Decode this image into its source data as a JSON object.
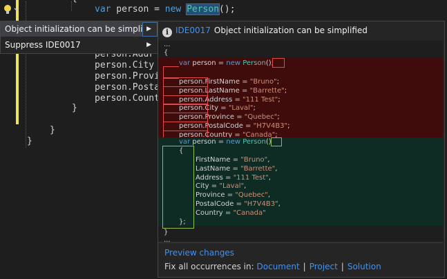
{
  "editor": {
    "line_top": "{",
    "line_var": {
      "kw": "var",
      "name": " person = ",
      "kw2": "new",
      "type": "Person",
      "rest": "();"
    },
    "lines": [
      "person.Addr",
      "person.City",
      "person.Provi",
      "person.Posta",
      "person.Count"
    ],
    "brace_inner": "}",
    "brace_mid": "}",
    "brace_outer": "}"
  },
  "menu": {
    "items": [
      {
        "label": "Object initialization can be simplified",
        "has_submenu": true
      },
      {
        "label": "Suppress IDE0017",
        "has_submenu": true
      }
    ]
  },
  "preview": {
    "diag_id": "IDE0017",
    "title": "Object initialization can be simplified",
    "ellipsis_top": "...",
    "brace_open": "{",
    "removed": {
      "decl": {
        "kw": "var",
        "mid": " person = ",
        "kw2": "new",
        "type": "Person",
        "tail": "();"
      },
      "assignments": [
        {
          "prop": "person.FirstName",
          "eq": " = ",
          "val": "\"Bruno\"",
          "end": ";"
        },
        {
          "prop": "person.LastName",
          "eq": " = ",
          "val": "\"Barrette\"",
          "end": ";"
        },
        {
          "prop": "person.Address",
          "eq": " = ",
          "val": "\"111 Test\"",
          "end": ";"
        },
        {
          "prop": "person.City",
          "eq": " = ",
          "val": "\"Laval\"",
          "end": ";"
        },
        {
          "prop": "person.Province",
          "eq": " = ",
          "val": "\"Quebec\"",
          "end": ";"
        },
        {
          "prop": "person.PostalCode",
          "eq": " = ",
          "val": "\"H7V4B3\"",
          "end": ";"
        },
        {
          "prop": "person.Country",
          "eq": " = ",
          "val": "\"Canada\"",
          "end": ";"
        }
      ]
    },
    "added": {
      "decl": {
        "kw": "var",
        "mid": " person = ",
        "kw2": "new",
        "type": "Person",
        "tail": "()"
      },
      "open": "{",
      "inits": [
        {
          "prop": "FirstName",
          "eq": " = ",
          "val": "\"Bruno\"",
          "end": ","
        },
        {
          "prop": "LastName",
          "eq": " = ",
          "val": "\"Barrette\"",
          "end": ","
        },
        {
          "prop": "Address",
          "eq": " = ",
          "val": "\"111 Test\"",
          "end": ","
        },
        {
          "prop": "City",
          "eq": " = ",
          "val": "\"Laval\"",
          "end": ","
        },
        {
          "prop": "Province",
          "eq": " = ",
          "val": "\"Quebec\"",
          "end": ","
        },
        {
          "prop": "PostalCode",
          "eq": " = ",
          "val": "\"H7V4B3\"",
          "end": ","
        },
        {
          "prop": "Country",
          "eq": " = ",
          "val": "\"Canada\"",
          "end": ""
        }
      ],
      "close": "};"
    },
    "brace_close": "}",
    "ellipsis_bottom": "...",
    "preview_link": "Preview changes",
    "fix_all_label": "Fix all occurrences in:",
    "scopes": [
      "Document",
      "Project",
      "Solution"
    ],
    "scope_sep": "|"
  }
}
